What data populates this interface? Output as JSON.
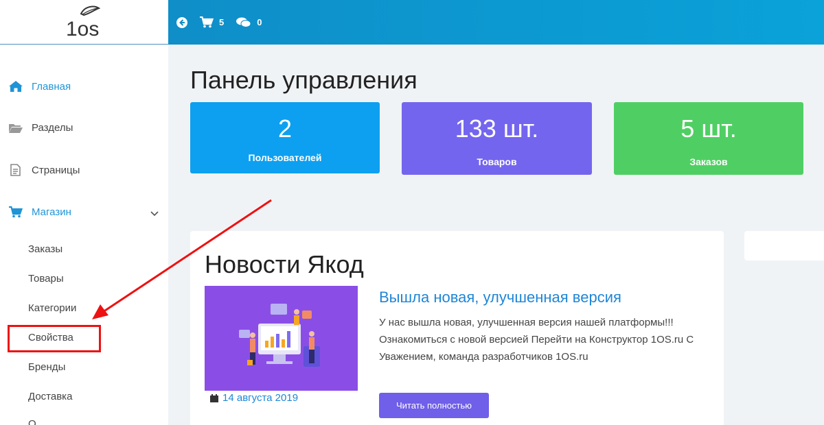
{
  "logo": {
    "text": "1os"
  },
  "topbar": {
    "cart_count": "5",
    "messages_count": "0"
  },
  "sidebar": {
    "items": [
      {
        "label": "Главная",
        "icon": "home-icon",
        "active": true
      },
      {
        "label": "Разделы",
        "icon": "folder-icon"
      },
      {
        "label": "Страницы",
        "icon": "page-icon"
      },
      {
        "label": "Магазин",
        "icon": "cart-icon",
        "active": true
      }
    ],
    "shop_subitems": [
      "Заказы",
      "Товары",
      "Категории",
      "Свойства",
      "Бренды",
      "Доставка",
      "О"
    ]
  },
  "main": {
    "title": "Панель управления",
    "stats": [
      {
        "value": "2",
        "label": "Пользователей",
        "color": "#0da0f0"
      },
      {
        "value": "133 шт.",
        "label": "Товаров",
        "color": "#7465ef"
      },
      {
        "value": "5 шт.",
        "label": "Заказов",
        "color": "#4fcf63"
      }
    ],
    "news": {
      "section_title": "Новости Якод",
      "headline": "Вышла новая, улучшенная версия",
      "text": "У нас вышла новая, улучшенная версия нашей платформы!!! Ознакомиться с новой версией Перейти на Конструктор 1OS.ru С Уважением, команда разработчиков 1OS.ru",
      "date": "14 августа 2019",
      "read_more": "Читать полностью"
    }
  },
  "colors": {
    "accent": "#1f94d6",
    "annotation": "#ee1111"
  }
}
